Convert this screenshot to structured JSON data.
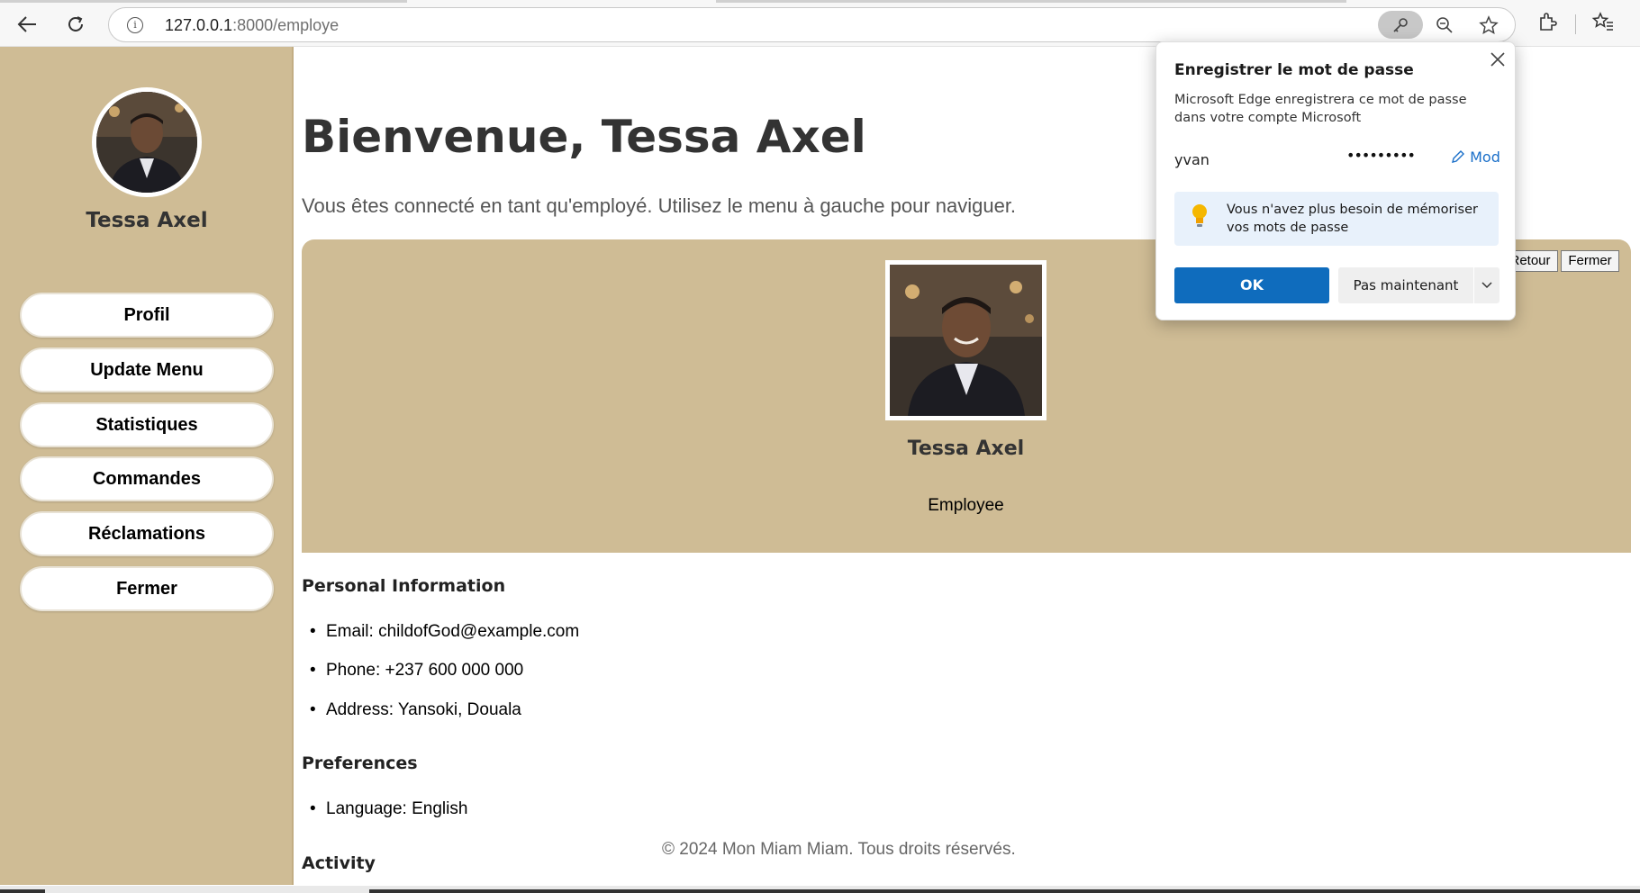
{
  "browser": {
    "url_host": "127.0.0.1",
    "url_path": ":8000/employe"
  },
  "sidebar": {
    "user_name": "Tessa Axel",
    "items": [
      {
        "label": "Profil"
      },
      {
        "label": "Update Menu"
      },
      {
        "label": "Statistiques"
      },
      {
        "label": "Commandes"
      },
      {
        "label": "Réclamations"
      },
      {
        "label": "Fermer"
      }
    ]
  },
  "main": {
    "title": "Bienvenue, Tessa Axel",
    "subtitle": "Vous êtes connecté en tant qu'employé. Utilisez le menu à gauche pour naviguer.",
    "card": {
      "retour_label": "Retour",
      "fermer_label": "Fermer",
      "name": "Tessa Axel",
      "role": "Employee"
    },
    "personal": {
      "title": "Personal Information",
      "email": "Email: childofGod@example.com",
      "phone": "Phone: +237 600 000 000",
      "address": "Address: Yansoki, Douala"
    },
    "preferences": {
      "title": "Preferences",
      "language": "Language: English"
    },
    "activity": {
      "title": "Activity"
    },
    "footer": "© 2024 Mon Miam Miam. Tous droits réservés."
  },
  "password_popup": {
    "title": "Enregistrer le mot de passe",
    "description": "Microsoft Edge enregistrera ce mot de passe dans votre compte Microsoft",
    "username": "yvan",
    "password_mask": "•••••••••",
    "edit_label": "Mod",
    "tip": "Vous n'avez plus besoin de mémoriser vos mots de passe",
    "ok_label": "OK",
    "later_label": "Pas maintenant"
  },
  "colors": {
    "sidebar_bg": "#cfbc95",
    "card_bg": "#cfbc95",
    "ok_blue": "#0f6cbd"
  }
}
